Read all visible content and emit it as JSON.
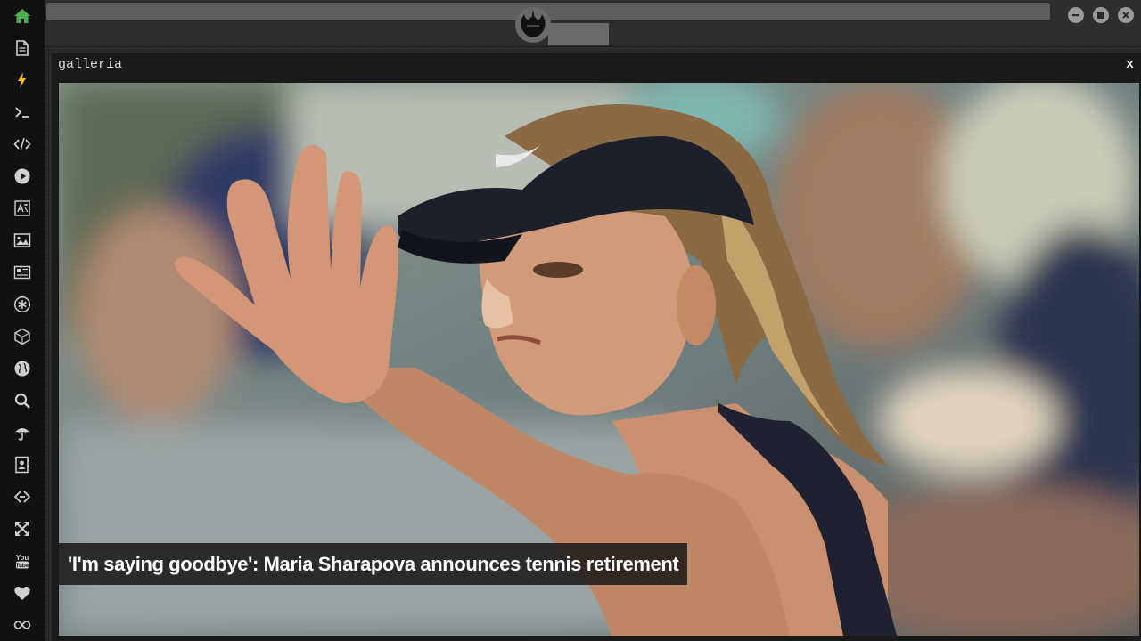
{
  "panel": {
    "title": "galleria",
    "close_label": "x"
  },
  "gallery": {
    "caption": "'I'm saying goodbye': Maria Sharapova announces tennis retirement"
  },
  "sidebar": {
    "items": [
      {
        "name": "home-icon",
        "color": "#4caf50"
      },
      {
        "name": "document-icon"
      },
      {
        "name": "lightning-icon",
        "color": "#f5c518"
      },
      {
        "name": "terminal-icon"
      },
      {
        "name": "code-icon"
      },
      {
        "name": "play-icon"
      },
      {
        "name": "translate-icon"
      },
      {
        "name": "image-icon"
      },
      {
        "name": "newspaper-icon"
      },
      {
        "name": "asterisk-icon"
      },
      {
        "name": "cube-icon"
      },
      {
        "name": "globe-icon"
      },
      {
        "name": "search-icon"
      },
      {
        "name": "umbrella-icon"
      },
      {
        "name": "contact-book-icon"
      },
      {
        "name": "link-icon"
      },
      {
        "name": "expand-icon"
      },
      {
        "name": "youtube-icon"
      },
      {
        "name": "heart-icon"
      },
      {
        "name": "infinity-icon"
      }
    ]
  },
  "window_controls": [
    "minimize-icon",
    "maximize-icon",
    "close-icon"
  ]
}
